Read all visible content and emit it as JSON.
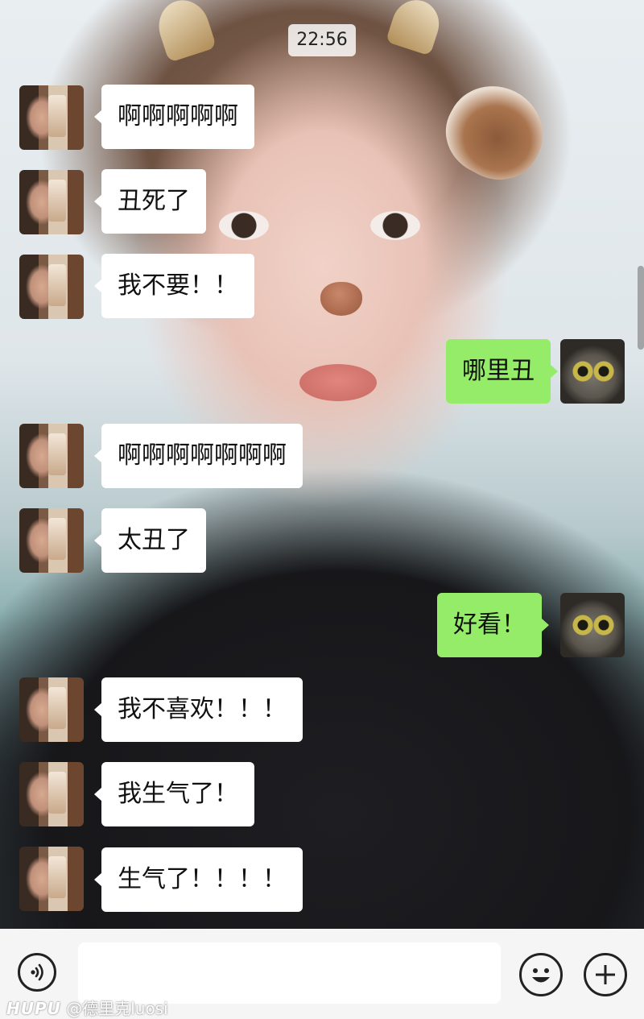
{
  "status": {
    "time": "22:56"
  },
  "messages": [
    {
      "side": "in",
      "text": "啊啊啊啊啊"
    },
    {
      "side": "in",
      "text": "丑死了"
    },
    {
      "side": "in",
      "text": "我不要！！"
    },
    {
      "side": "out",
      "text": "哪里丑"
    },
    {
      "side": "in",
      "text": "啊啊啊啊啊啊啊"
    },
    {
      "side": "in",
      "text": "太丑了"
    },
    {
      "side": "out",
      "text": "好看！"
    },
    {
      "side": "in",
      "text": "我不喜欢！！！"
    },
    {
      "side": "in",
      "text": "我生气了！"
    },
    {
      "side": "in",
      "text": "生气了！！！！"
    }
  ],
  "input_bar": {
    "message_value": "",
    "voice_icon": "voice-icon",
    "emoji_icon": "emoji-icon",
    "plus_icon": "plus-icon"
  },
  "watermark": {
    "logo": "HUPU",
    "text": "@德里克luosi"
  },
  "colors": {
    "outgoing_bubble": "#95ec69",
    "incoming_bubble": "#ffffff",
    "input_bar": "#f5f5f5"
  }
}
